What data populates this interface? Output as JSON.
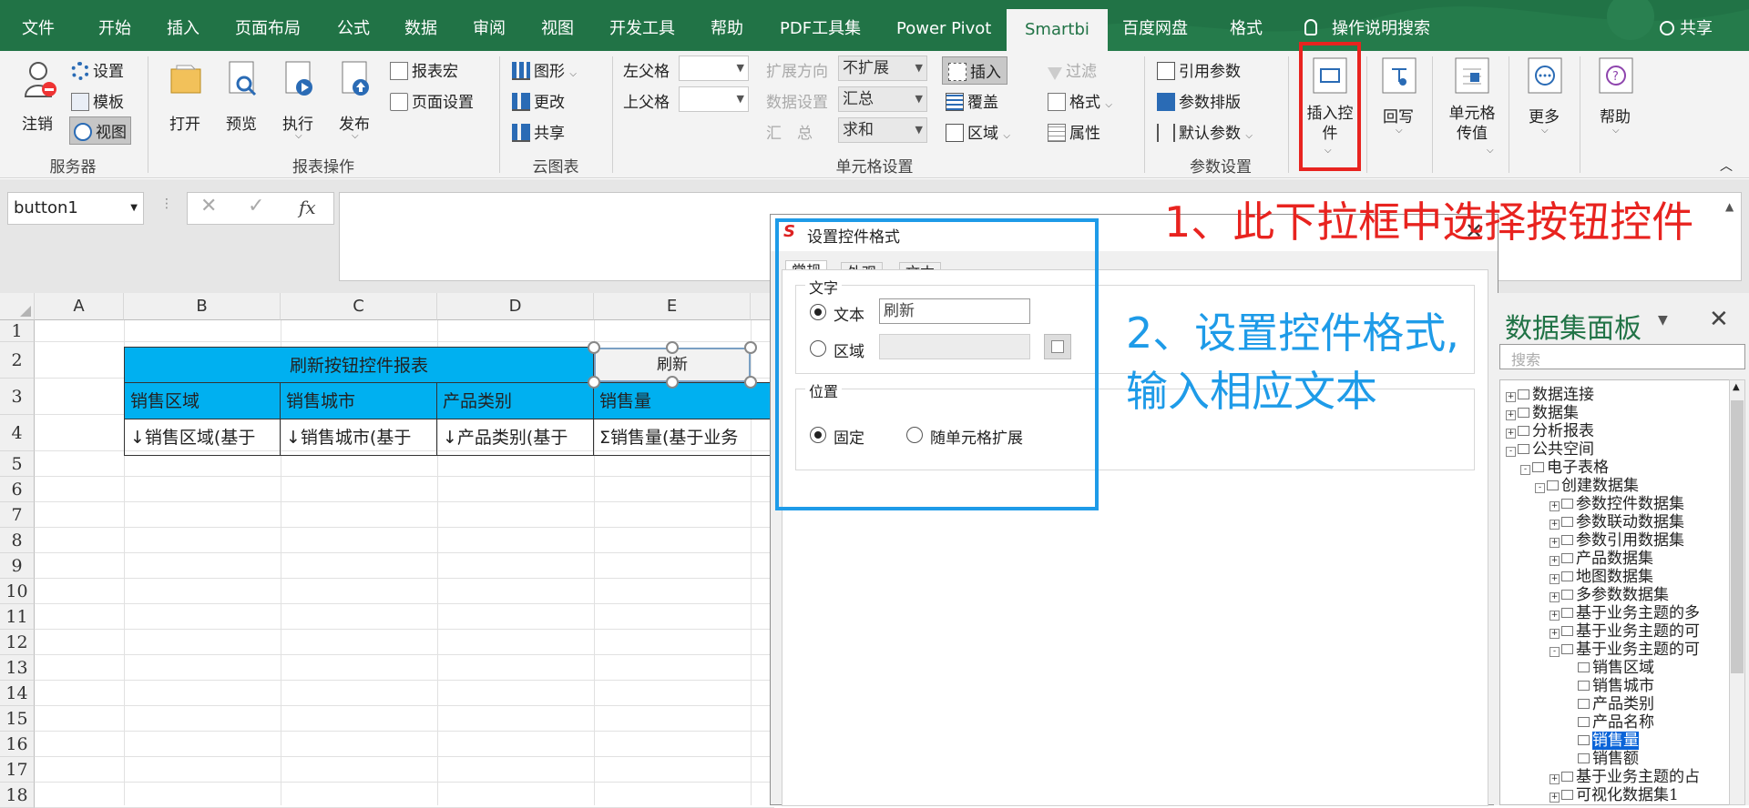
{
  "tabs": [
    {
      "label": "文件",
      "active": false
    },
    {
      "label": "开始",
      "active": false
    },
    {
      "label": "插入",
      "active": false
    },
    {
      "label": "页面布局",
      "active": false
    },
    {
      "label": "公式",
      "active": false
    },
    {
      "label": "数据",
      "active": false
    },
    {
      "label": "审阅",
      "active": false
    },
    {
      "label": "视图",
      "active": false
    },
    {
      "label": "开发工具",
      "active": false
    },
    {
      "label": "帮助",
      "active": false
    },
    {
      "label": "PDF工具集",
      "active": false
    },
    {
      "label": "Power Pivot",
      "active": false
    },
    {
      "label": "Smartbi",
      "active": true
    },
    {
      "label": "百度网盘",
      "active": false
    },
    {
      "label": "格式",
      "active": false
    }
  ],
  "search_tab": "操作说明搜索",
  "share": "共享",
  "ribbon": {
    "server": {
      "logout": "注销",
      "settings": "设置",
      "template": "模板",
      "view": "视图",
      "group": "服务器"
    },
    "report": {
      "open": "打开",
      "preview": "预览",
      "execute": "执行",
      "publish": "发布",
      "macro": "报表宏",
      "page_setup": "页面设置",
      "group": "报表操作"
    },
    "cloud": {
      "graph": "图形",
      "change": "更改",
      "share": "共享",
      "group": "云图表"
    },
    "cell": {
      "left_parent": "左父格",
      "upper_parent": "上父格",
      "expand_dir": "扩展方向",
      "data_setting": "数据设置",
      "summary_label": "汇　总",
      "expand_val": "不扩展",
      "data_val": "汇总",
      "sum_val": "求和",
      "insert": "插入",
      "cover": "覆盖",
      "region": "区域",
      "filter": "过滤",
      "format": "格式",
      "attribute": "属性",
      "group": "单元格设置"
    },
    "param": {
      "ref_param": "引用参数",
      "param_layout": "参数排版",
      "default_param": "默认参数",
      "group": "参数设置"
    },
    "insert_control": "插入控件",
    "writeback": "回写",
    "cell_pass": "单元格传值",
    "more": "更多",
    "help": "帮助"
  },
  "namebox": "button1",
  "columns": [
    "A",
    "B",
    "C",
    "D",
    "E"
  ],
  "rows": [
    "1",
    "2",
    "3",
    "4",
    "5",
    "6",
    "7",
    "8",
    "9",
    "10",
    "11",
    "12",
    "13",
    "14",
    "15",
    "16",
    "17",
    "18"
  ],
  "report": {
    "title": "刷新按钮控件报表",
    "button": "刷新",
    "headers": [
      "销售区域",
      "销售城市",
      "产品类别",
      "销售量"
    ],
    "fields": [
      "↓销售区域(基于",
      "↓销售城市(基于",
      "↓产品类别(基于",
      "Σ销售量(基于业务"
    ]
  },
  "dialog": {
    "title": "设置控件格式",
    "tabs": [
      "常规",
      "外观",
      "文本"
    ],
    "text_group": "文字",
    "text_radio": "文本",
    "text_value": "刷新",
    "region_radio": "区域",
    "position_group": "位置",
    "fixed": "固定",
    "expand_with_cell": "随单元格扩展"
  },
  "panel": {
    "title": "数据集面板",
    "search_placeholder": "搜索",
    "tree": [
      {
        "label": "数据连接",
        "level": 0,
        "box": "+"
      },
      {
        "label": "数据集",
        "level": 0,
        "box": "+"
      },
      {
        "label": "分析报表",
        "level": 0,
        "box": "+"
      },
      {
        "label": "公共空间",
        "level": 0,
        "box": "-"
      },
      {
        "label": "电子表格",
        "level": 1,
        "box": "-"
      },
      {
        "label": "创建数据集",
        "level": 2,
        "box": "-"
      },
      {
        "label": "参数控件数据集",
        "level": 3,
        "box": "+"
      },
      {
        "label": "参数联动数据集",
        "level": 3,
        "box": "+"
      },
      {
        "label": "参数引用数据集",
        "level": 3,
        "box": "+"
      },
      {
        "label": "产品数据集",
        "level": 3,
        "box": "+"
      },
      {
        "label": "地图数据集",
        "level": 3,
        "box": "+"
      },
      {
        "label": "多参数数据集",
        "level": 3,
        "box": "+"
      },
      {
        "label": "基于业务主题的多",
        "level": 3,
        "box": "+"
      },
      {
        "label": "基于业务主题的可",
        "level": 3,
        "box": "+"
      },
      {
        "label": "基于业务主题的可",
        "level": 3,
        "box": "-"
      },
      {
        "label": "销售区域",
        "level": 4,
        "box": ""
      },
      {
        "label": "销售城市",
        "level": 4,
        "box": ""
      },
      {
        "label": "产品类别",
        "level": 4,
        "box": ""
      },
      {
        "label": "产品名称",
        "level": 4,
        "box": ""
      },
      {
        "label": "销售量",
        "level": 4,
        "box": "",
        "selected": true
      },
      {
        "label": "销售额",
        "level": 4,
        "box": ""
      },
      {
        "label": "基于业务主题的占",
        "level": 3,
        "box": "+"
      },
      {
        "label": "可视化数据集1",
        "level": 3,
        "box": "+"
      }
    ]
  },
  "annotations": {
    "step1": "1、此下拉框中选择按钮控件",
    "step2_line1": "2、设置控件格式,",
    "step2_line2": "输入相应文本"
  },
  "colors": {
    "excel_green": "#217346",
    "header_blue": "#00b0f0",
    "annotation_red": "#e8231f",
    "annotation_blue": "#1e9be8"
  }
}
